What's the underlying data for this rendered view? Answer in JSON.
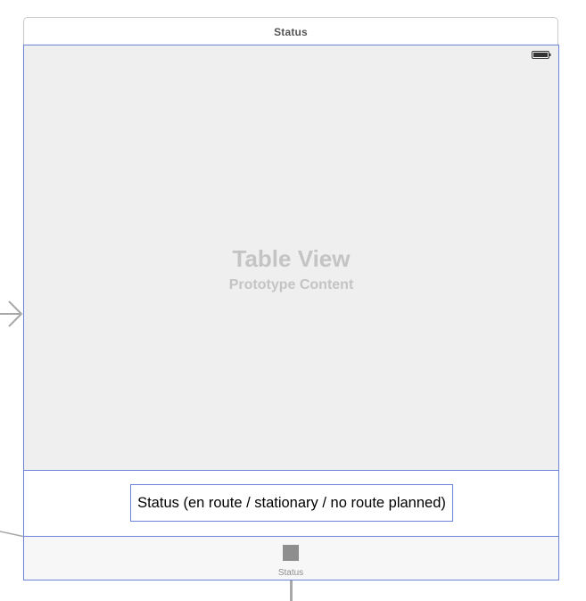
{
  "scene": {
    "title": "Status"
  },
  "table_view": {
    "title": "Table View",
    "subtitle": "Prototype Content"
  },
  "footer": {
    "status_label": "Status (en route / stationary / no route planned)"
  },
  "tab_bar": {
    "items": [
      {
        "label": "Status",
        "icon": "square-icon"
      }
    ]
  },
  "icons": {
    "entry": "entry-arrow-icon",
    "battery": "battery-icon"
  },
  "colors": {
    "selection_outline": "#6d83d8",
    "table_background": "#efefef",
    "placeholder_text": "#c4c4c4",
    "tab_icon": "#8e8e8e"
  }
}
